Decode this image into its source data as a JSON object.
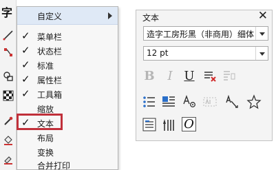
{
  "toolbox": {
    "title_glyph": "字"
  },
  "menu": {
    "items": [
      {
        "label": "自定义",
        "checked": false
      },
      {
        "label": "菜单栏",
        "checked": true
      },
      {
        "label": "状态栏",
        "checked": true
      },
      {
        "label": "标准",
        "checked": true
      },
      {
        "label": "属性栏",
        "checked": true
      },
      {
        "label": "工具箱",
        "checked": true
      },
      {
        "label": "缩放",
        "checked": false
      },
      {
        "label": "文本",
        "checked": true
      },
      {
        "label": "布局",
        "checked": false
      },
      {
        "label": "变换",
        "checked": false
      },
      {
        "label": "合并打印",
        "checked": false
      }
    ],
    "check_glyph": "✓"
  },
  "panel": {
    "title": "文本",
    "close_glyph": "✕",
    "font_name": "造字工房形黑（非商用）细体",
    "font_size": "12 pt",
    "btn_bold": "B",
    "btn_italic": "I",
    "btn_underline": "U",
    "btn_frame": "O"
  },
  "colors": {
    "menu_top": "#dfe9f6",
    "highlight": "#c0303a",
    "accent_blue": "#2a6fc9",
    "accent_red": "#d12b2b"
  }
}
